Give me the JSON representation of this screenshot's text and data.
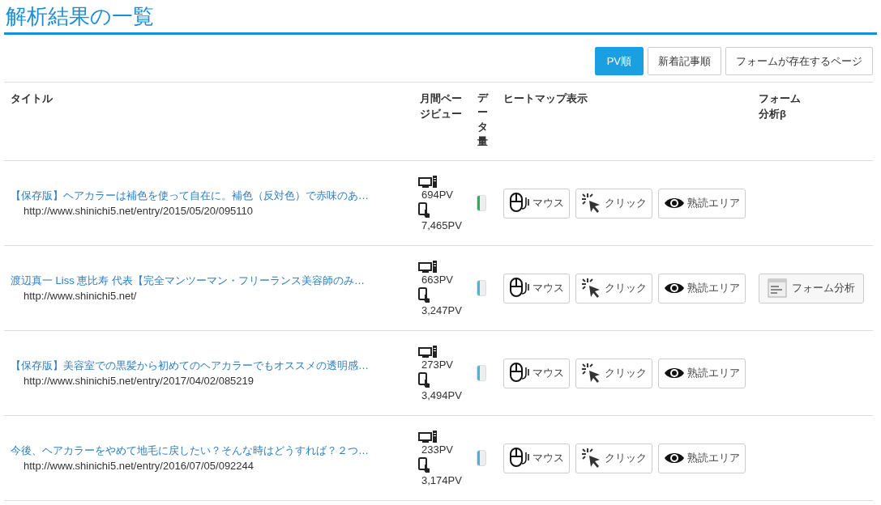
{
  "page_title": "解析結果の一覧",
  "sort_buttons": [
    {
      "label": "PV順",
      "selected": true
    },
    {
      "label": "新着記事順",
      "selected": false
    },
    {
      "label": "フォームが存在するページ",
      "selected": false
    }
  ],
  "table": {
    "columns": [
      "タイトル",
      "月間ページビュー",
      "データ量",
      "ヒートマップ表示",
      "フォーム分析β"
    ],
    "rows": [
      {
        "title": "【保存版】ヘアカラーは補色を使って自在に。補色（反対色）で赤味のあ…",
        "url": "http://www.shinichi5.net/entry/2015/05/20/095110",
        "pc_pv": "694PV",
        "mobile_pv": "7,465PV",
        "data": {
          "color": "#1fb35a"
        },
        "heatmap": [
          "マウス",
          "クリック",
          "熟読エリア"
        ]
      },
      {
        "title": "渡辺真一 Liss 恵比寿 代表【完全マンツーマン・フリーランス美容師のみ…",
        "url": "http://www.shinichi5.net/",
        "pc_pv": "663PV",
        "mobile_pv": "3,247PV",
        "data": {
          "color": "#3bbcd4"
        },
        "heatmap": [
          "マウス",
          "クリック",
          "熟読エリア"
        ],
        "form_button": "フォーム分析"
      },
      {
        "title": "【保存版】美容室での黒髪から初めてのヘアカラーでもオススメの透明感…",
        "url": "http://www.shinichi5.net/entry/2017/04/02/085219",
        "pc_pv": "273PV",
        "mobile_pv": "3,494PV",
        "data": {
          "color": "#3bbcd4"
        },
        "heatmap": [
          "マウス",
          "クリック",
          "熟読エリア"
        ]
      },
      {
        "title": "今後、ヘアカラーをやめて地毛に戻したい？そんな時はどうすれば？２つ…",
        "url": "http://www.shinichi5.net/entry/2016/07/05/092244",
        "pc_pv": "233PV",
        "mobile_pv": "3,174PV",
        "data": {
          "color": "#3bbcd4"
        },
        "heatmap": [
          "マウス",
          "クリック",
          "熟読エリア"
        ]
      }
    ]
  }
}
